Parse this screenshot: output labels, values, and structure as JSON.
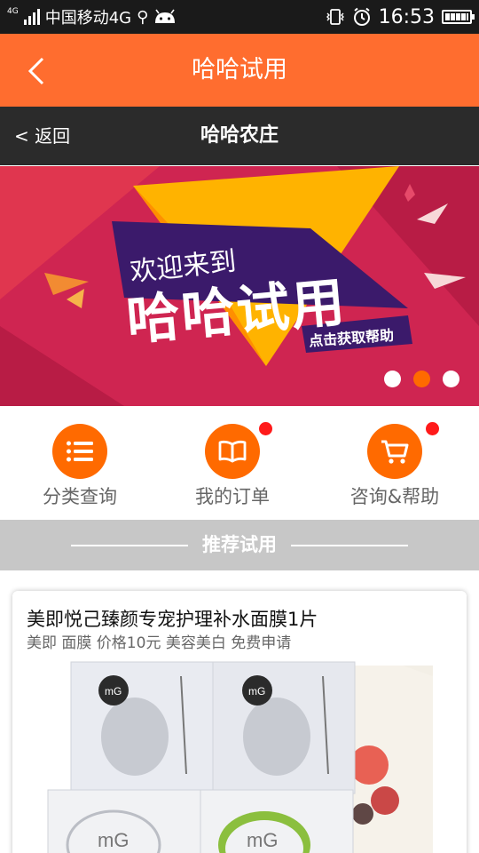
{
  "status_bar": {
    "network": "4G",
    "carrier": "中国移动4G",
    "time": "16:53"
  },
  "header": {
    "title": "哈哈试用"
  },
  "sub_header": {
    "back_label": "< 返回",
    "title": "哈哈农庄"
  },
  "banner": {
    "line1": "欢迎来到",
    "line2": "哈哈试用",
    "cta": "点击获取帮助",
    "slide_count": 3,
    "active_slide": 2
  },
  "features": [
    {
      "label": "分类查询",
      "icon": "list-icon",
      "badge": false
    },
    {
      "label": "我的订单",
      "icon": "book-icon",
      "badge": true
    },
    {
      "label": "咨询&帮助",
      "icon": "cart-icon",
      "badge": true
    }
  ],
  "section": {
    "title": "推荐试用"
  },
  "product": {
    "title": "美即悦己臻颜专宠护理补水面膜1片",
    "tags": "美即 面膜 价格10元 美容美白 免费申请",
    "brand_logo": "mG"
  },
  "colors": {
    "accent": "#ff6d2f",
    "dark_bar": "#2b2b2b",
    "badge": "#ff1a1a"
  }
}
